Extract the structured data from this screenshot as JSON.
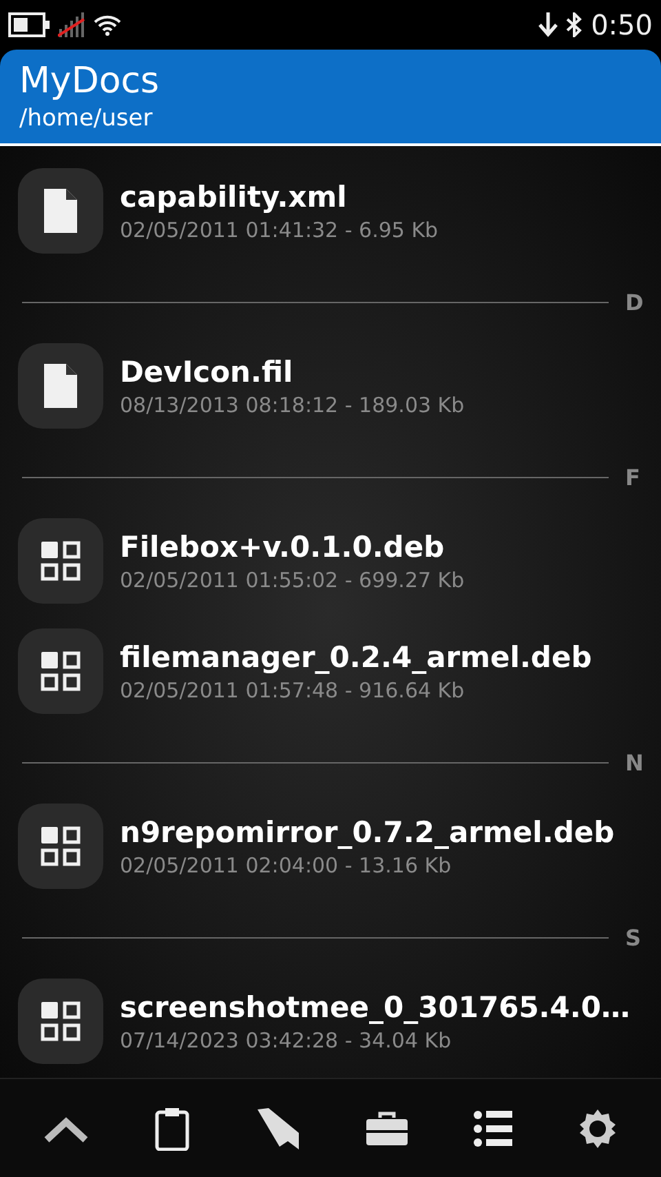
{
  "status_bar": {
    "time": "0:50"
  },
  "header": {
    "title": "MyDocs",
    "path": "/home/user"
  },
  "list": [
    {
      "kind": "document",
      "name": "capability.xml",
      "details": "02/05/2011 01:41:32 - 6.95 Kb"
    },
    {
      "kind": "section",
      "letter": "D"
    },
    {
      "kind": "document",
      "name": "DevIcon.fil",
      "details": "08/13/2013 08:18:12 - 189.03 Kb"
    },
    {
      "kind": "section",
      "letter": "F"
    },
    {
      "kind": "package",
      "name": "Filebox+v.0.1.0.deb",
      "details": "02/05/2011 01:55:02 - 699.27 Kb"
    },
    {
      "kind": "package",
      "name": "filemanager_0.2.4_armel.deb",
      "details": "02/05/2011 01:57:48 - 916.64 Kb"
    },
    {
      "kind": "section",
      "letter": "N"
    },
    {
      "kind": "package",
      "name": "n9repomirror_0.7.2_armel.deb",
      "details": "02/05/2011 02:04:00 - 13.16 Kb"
    },
    {
      "kind": "section",
      "letter": "S"
    },
    {
      "kind": "package",
      "name": "screenshotmee_0_301765.4.0…",
      "details": "07/14/2023 03:42:28 - 34.04 Kb"
    }
  ]
}
